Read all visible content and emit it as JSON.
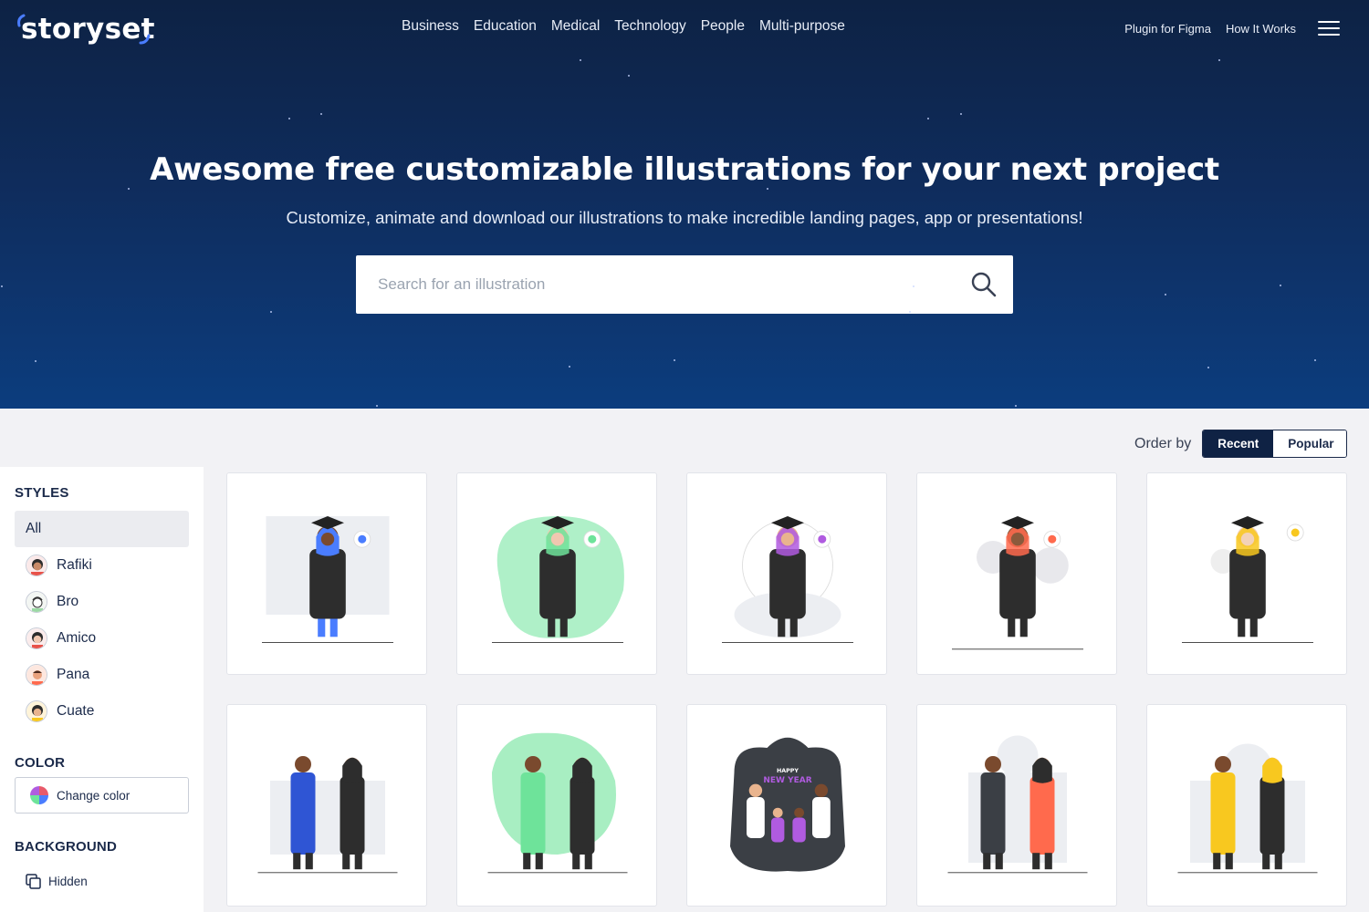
{
  "brand": {
    "name": "storyset",
    "accent": "#4a7dff"
  },
  "nav": {
    "categories": [
      "Business",
      "Education",
      "Medical",
      "Technology",
      "People",
      "Multi-purpose"
    ],
    "plugin": "Plugin for Figma",
    "how": "How It Works",
    "menu_icon": "hamburger-icon"
  },
  "hero": {
    "title": "Awesome free customizable illustrations for your next project",
    "subtitle": "Customize, animate and download our illustrations to make incredible landing pages, app or presentations!",
    "search_placeholder": "Search for an illustration",
    "search_icon": "search-icon"
  },
  "order": {
    "label": "Order by",
    "options": [
      "Recent",
      "Popular"
    ],
    "selected": "Recent"
  },
  "sidebar": {
    "styles_heading": "STYLES",
    "styles": [
      "All",
      "Rafiki",
      "Bro",
      "Amico",
      "Pana",
      "Cuate"
    ],
    "selected_style": "All",
    "color_heading": "COLOR",
    "change_color": "Change color",
    "background_heading": "BACKGROUND",
    "background_value": "Hidden"
  },
  "illustrations": [
    {
      "topic": "graduation",
      "accent": "#4a7dff"
    },
    {
      "topic": "graduation",
      "accent": "#6ee39a"
    },
    {
      "topic": "graduation",
      "accent": "#b05be0"
    },
    {
      "topic": "graduation",
      "accent": "#ff6a4d"
    },
    {
      "topic": "graduation",
      "accent": "#f8c81f"
    },
    {
      "topic": "celebration",
      "accent": "#2f55d4"
    },
    {
      "topic": "celebration",
      "accent": "#6ee39a"
    },
    {
      "topic": "new-year",
      "accent": "#b05be0",
      "text": "HAPPY NEW YEAR"
    },
    {
      "topic": "celebration",
      "accent": "#ff6a4d"
    },
    {
      "topic": "celebration",
      "accent": "#f8c81f"
    }
  ]
}
